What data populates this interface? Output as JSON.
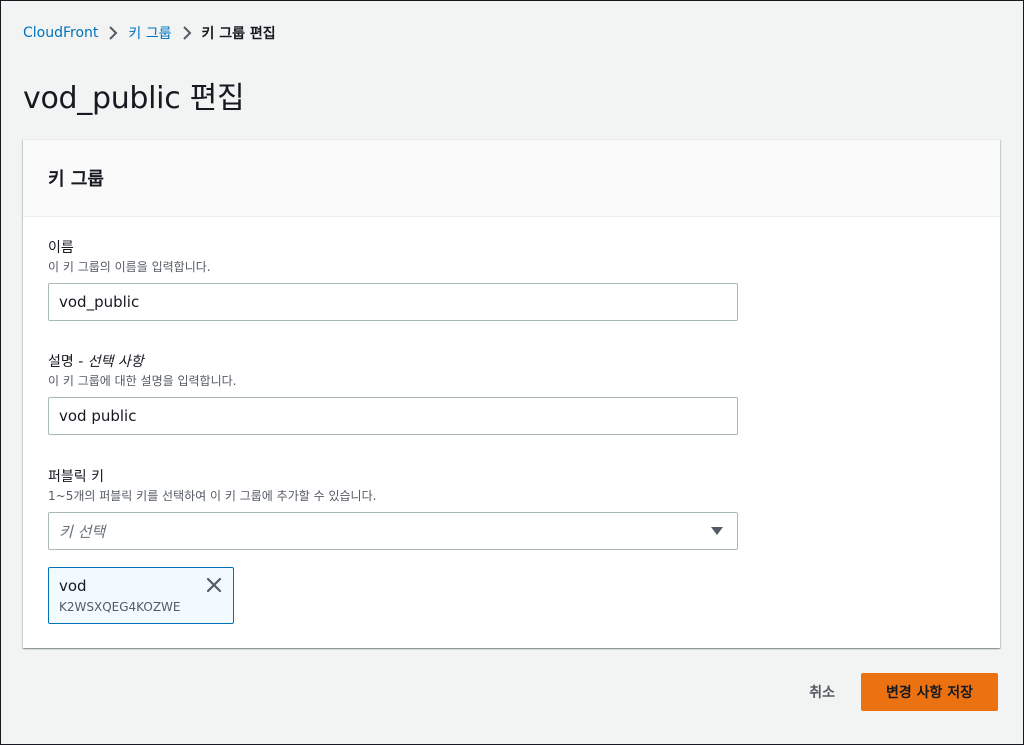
{
  "breadcrumb": {
    "items": [
      "CloudFront",
      "키 그룹",
      "키 그룹 편집"
    ]
  },
  "page": {
    "title": "vod_public 편집"
  },
  "panel": {
    "title": "키 그룹"
  },
  "form": {
    "name": {
      "label": "이름",
      "description": "이 키 그룹의 이름을 입력합니다.",
      "value": "vod_public"
    },
    "description": {
      "label": "설명 - ",
      "label_optional": "선택 사항",
      "description": "이 키 그룹에 대한 설명을 입력합니다.",
      "value": "vod public"
    },
    "public_keys": {
      "label": "퍼블릭 키",
      "description": "1~5개의 퍼블릭 키를 선택하여 이 키 그룹에 추가할 수 있습니다.",
      "placeholder": "키 선택",
      "selected": [
        {
          "name": "vod",
          "id": "K2WSXQEG4KOZWE"
        }
      ]
    }
  },
  "actions": {
    "cancel": "취소",
    "save": "변경 사항 저장"
  },
  "colors": {
    "link": "#0073bb",
    "primary": "#ec7211",
    "token_border": "#0073bb",
    "token_bg": "#f1faff"
  },
  "icons": {
    "breadcrumb_separator": "chevron-right-icon",
    "select_caret": "caret-down-icon",
    "token_remove": "close-icon"
  }
}
